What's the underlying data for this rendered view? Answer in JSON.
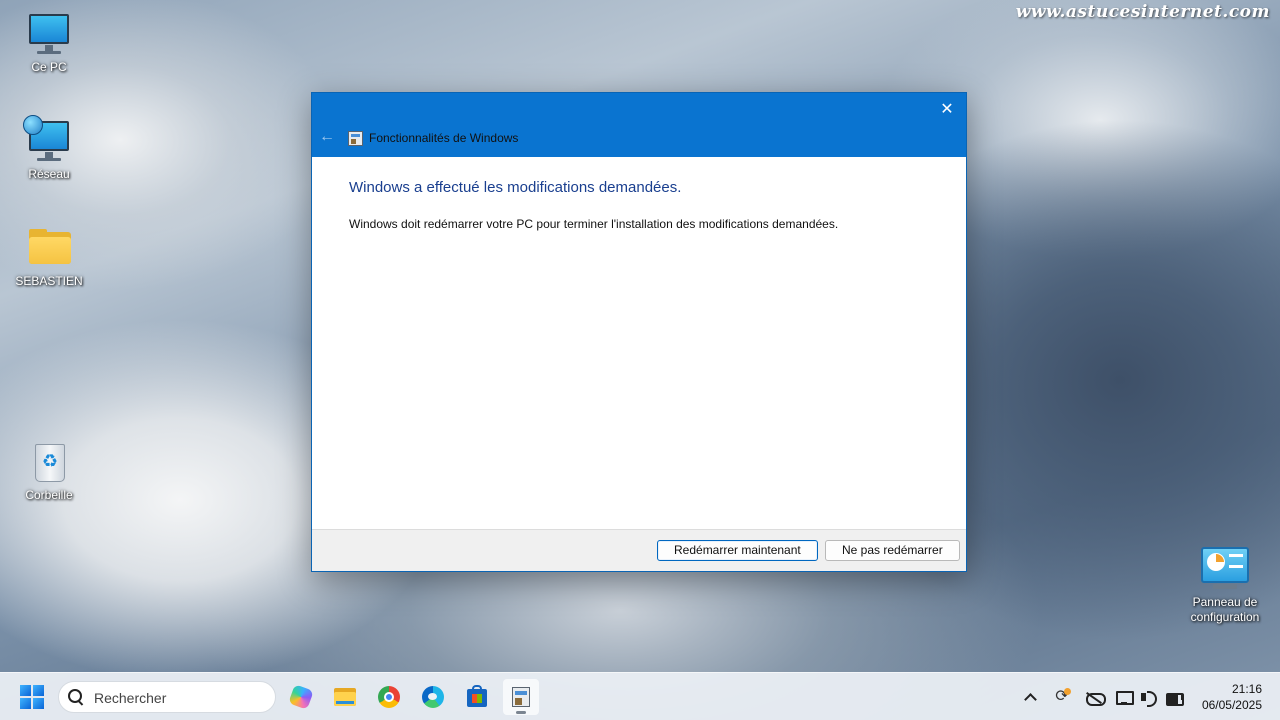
{
  "watermark": "www.astucesinternet.com",
  "desktop": {
    "icons": [
      {
        "label": "Ce PC"
      },
      {
        "label": "Réseau"
      },
      {
        "label": "SEBASTIEN"
      },
      {
        "label": "Corbeille"
      },
      {
        "label": "Panneau de configuration"
      }
    ]
  },
  "dialog": {
    "title": "Fonctionnalités de Windows",
    "heading": "Windows a effectué les modifications demandées.",
    "message": "Windows doit redémarrer votre PC pour terminer l'installation des modifications demandées.",
    "buttons": {
      "restart_now": "Redémarrer maintenant",
      "dont_restart": "Ne pas redémarrer"
    },
    "close_glyph": "✕",
    "back_glyph": "←"
  },
  "taskbar": {
    "search_placeholder": "Rechercher",
    "apps": [
      "copilot-icon",
      "file-explorer-icon",
      "chrome-icon",
      "edge-icon",
      "store-icon",
      "windows-features-icon"
    ],
    "tray": [
      "chevron-up-icon",
      "sync-icon",
      "cloud-off-icon",
      "network-icon",
      "volume-icon",
      "battery-icon"
    ],
    "clock": {
      "time": "21:16",
      "date": "06/05/2025"
    }
  },
  "colors": {
    "accent": "#0a74d0",
    "heading": "#1a3f8f"
  }
}
